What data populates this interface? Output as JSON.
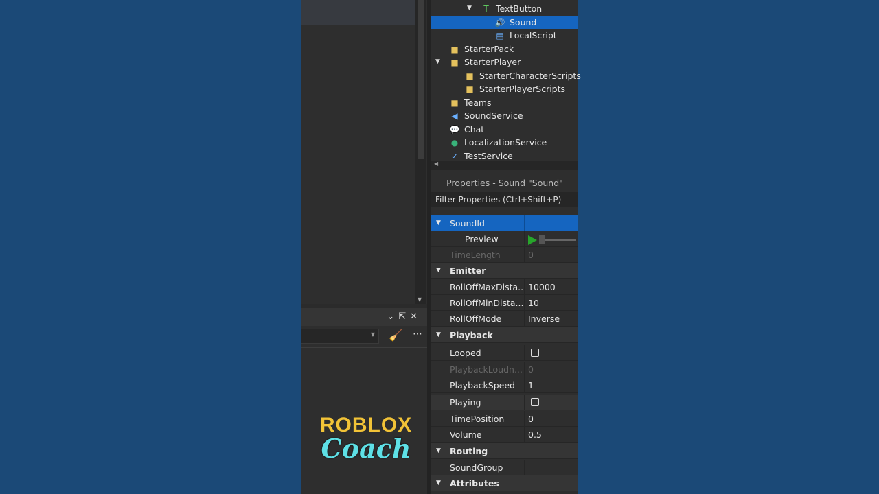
{
  "explorer": {
    "items": [
      {
        "label": "TextButton",
        "icon": "textbutton-icon",
        "expanded": true
      },
      {
        "label": "Sound",
        "icon": "sound-icon",
        "selected": true
      },
      {
        "label": "LocalScript",
        "icon": "localscript-icon"
      },
      {
        "label": "StarterPack",
        "icon": "folder-icon"
      },
      {
        "label": "StarterPlayer",
        "icon": "folder-icon",
        "expanded": true
      },
      {
        "label": "StarterCharacterScripts",
        "icon": "folder-icon"
      },
      {
        "label": "StarterPlayerScripts",
        "icon": "folder-icon"
      },
      {
        "label": "Teams",
        "icon": "folder-icon"
      },
      {
        "label": "SoundService",
        "icon": "soundservice-icon"
      },
      {
        "label": "Chat",
        "icon": "chat-icon"
      },
      {
        "label": "LocalizationService",
        "icon": "localization-icon"
      },
      {
        "label": "TestService",
        "icon": "testservice-icon"
      }
    ]
  },
  "properties": {
    "title": "Properties - Sound \"Sound\"",
    "filter_placeholder": "Filter Properties (Ctrl+Shift+P)",
    "rows": [
      {
        "name": "SoundId",
        "type": "category-selected"
      },
      {
        "name": "Preview",
        "type": "preview"
      },
      {
        "name": "TimeLength",
        "value": "0",
        "disabled": true
      },
      {
        "name": "Emitter",
        "type": "category"
      },
      {
        "name": "RollOffMaxDista...",
        "value": "10000"
      },
      {
        "name": "RollOffMinDista...",
        "value": "10"
      },
      {
        "name": "RollOffMode",
        "value": "Inverse"
      },
      {
        "name": "Playback",
        "type": "category"
      },
      {
        "name": "Looped",
        "checked": false
      },
      {
        "name": "PlaybackLoudn...",
        "value": "0",
        "disabled": true
      },
      {
        "name": "PlaybackSpeed",
        "value": "1"
      },
      {
        "name": "Playing",
        "checked": false
      },
      {
        "name": "TimePosition",
        "value": "0"
      },
      {
        "name": "Volume",
        "value": "0.5"
      },
      {
        "name": "Routing",
        "type": "category"
      },
      {
        "name": "SoundGroup",
        "value": ""
      },
      {
        "name": "Attributes",
        "type": "category"
      }
    ]
  },
  "logo": {
    "line1": "ROBLOX",
    "line2": "Coach"
  },
  "colors": {
    "background": "#1b4977",
    "selection": "#1565c0",
    "play": "#27a52b"
  }
}
